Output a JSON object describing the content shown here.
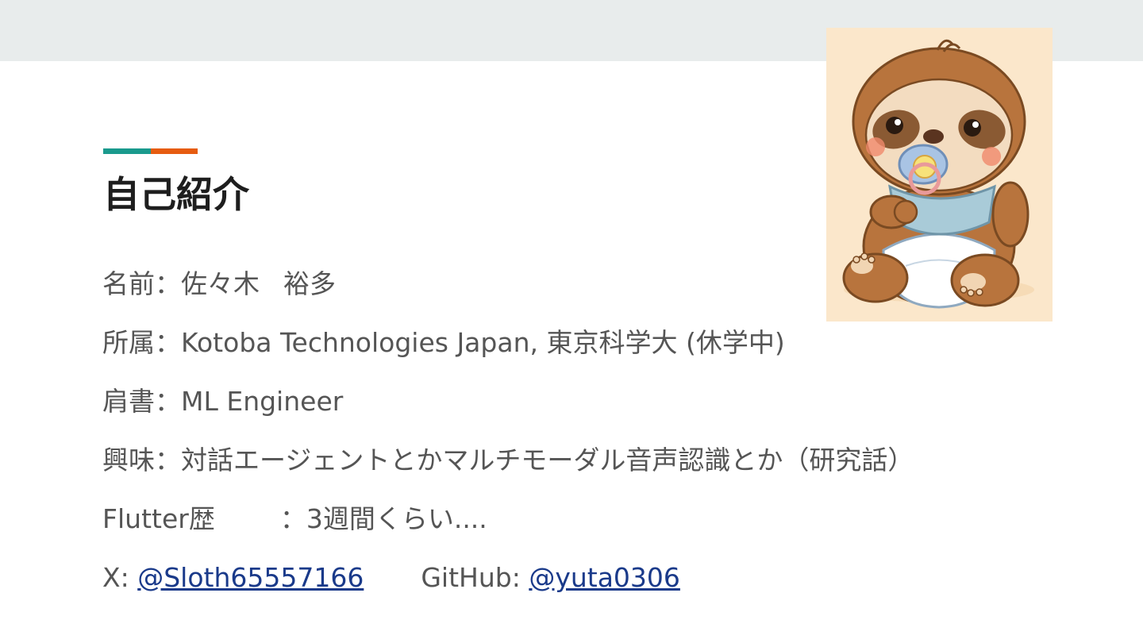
{
  "slide": {
    "title": "自己紹介",
    "colors": {
      "teal": "#1a9a8d",
      "orange": "#e65c10",
      "link": "#1a3a8a"
    }
  },
  "rows": {
    "name": {
      "label": "名前",
      "colon": "：",
      "value_family": "佐々木",
      "value_given": "裕多"
    },
    "affiliation": {
      "label": "所属",
      "colon": "：",
      "value": "Kotoba Technologies Japan, 東京科学大 (休学中)"
    },
    "title": {
      "label": "肩書",
      "colon": "：",
      "value": "ML Engineer"
    },
    "interests": {
      "label": "興味",
      "colon": "：",
      "value": "対話エージェントとかマルチモーダル音声認識とか（研究話）"
    },
    "flutter": {
      "label": "Flutter歴",
      "colon": "：",
      "value": "3週間くらい...."
    },
    "links": {
      "x_label": "X: ",
      "x_handle": "@Sloth65557166",
      "github_label": "GitHub: ",
      "github_handle": "@yuta0306"
    }
  },
  "image": {
    "icon": "baby-sloth-with-pacifier-illustration"
  }
}
